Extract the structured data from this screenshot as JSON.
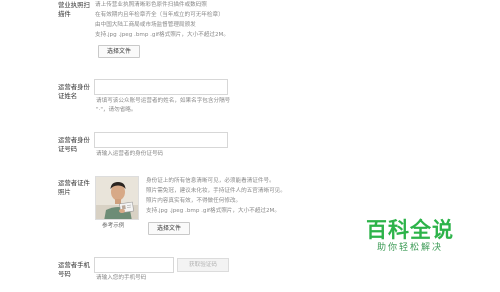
{
  "license": {
    "label_line1": "营业执照扫",
    "label_line2": "描件",
    "hints": [
      "请上传营业执照清晰彩色原件扫描件或数码照",
      "在有效期内且年检章齐全（当年成立的可无年检章）",
      "由中国大陆工商局或市场监督管理局颁发",
      "支持.jpg .jpeg .bmp .gif格式照片，大小不超过2M。"
    ],
    "button": "选择文件"
  },
  "operator_name": {
    "label_line1": "运营者身份",
    "label_line2": "证姓名",
    "hint_line1": "请填写该公众账号运营者的姓名，如果名字包含分隔号",
    "hint_line2": "\"·\"，请勿省略。"
  },
  "id_number": {
    "label_line1": "运营者身份",
    "label_line2": "证号码",
    "hint": "请输入运营者的身份证号码"
  },
  "id_photo": {
    "label_line1": "运营者证件",
    "label_line2": "照片",
    "hints": [
      "身份证上的所有信息清晰可见，必须能看清证件号。",
      "照片需免冠，建议未化妆，手持证件人的五官清晰可见。",
      "照片内容真实有效，不得做任何修改。",
      "支持.jpg .jpeg .bmp .gif格式照片，大小不超过2M。"
    ],
    "sample_caption": "参考示例",
    "button": "选择文件"
  },
  "phone": {
    "label_line1": "运营者手机",
    "label_line2": "号码",
    "code_button": "获取验证码",
    "hint": "请输入您的手机号码"
  },
  "watermark": {
    "title": "百科全说",
    "subtitle": "助你轻松解决"
  }
}
